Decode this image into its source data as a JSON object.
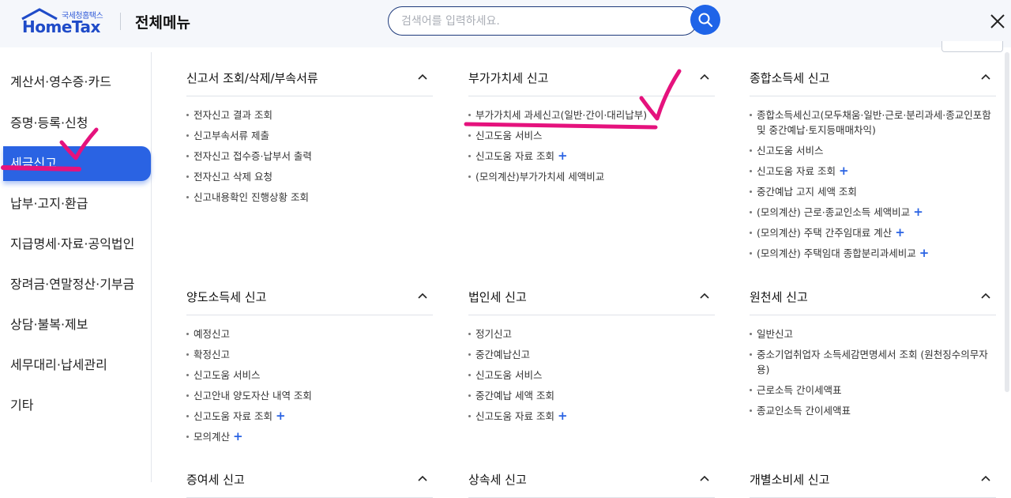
{
  "header": {
    "logo_sub": "국세청홈택스",
    "logo_main": "HomeTax",
    "menu_title": "전체메뉴",
    "search_placeholder": "검색어를 입력하세요."
  },
  "sidebar": {
    "items": [
      {
        "label": "계산서·영수증·카드"
      },
      {
        "label": "증명·등록·신청"
      },
      {
        "label": "세금신고",
        "active": true
      },
      {
        "label": "납부·고지·환급"
      },
      {
        "label": "지급명세·자료·공익법인"
      },
      {
        "label": "장려금·연말정산·기부금"
      },
      {
        "label": "상담·불복·제보"
      },
      {
        "label": "세무대리·납세관리"
      },
      {
        "label": "기타"
      }
    ]
  },
  "sections": [
    {
      "title": "신고서 조회/삭제/부속서류",
      "items": [
        {
          "label": "전자신고 결과 조회"
        },
        {
          "label": "신고부속서류 제출"
        },
        {
          "label": "전자신고 접수증·납부서 출력"
        },
        {
          "label": "전자신고 삭제 요청"
        },
        {
          "label": "신고내용확인 진행상황 조회"
        }
      ]
    },
    {
      "title": "부가가치세 신고",
      "items": [
        {
          "label": "부가가치세 과세신고(일반·간이·대리납부)"
        },
        {
          "label": "신고도움 서비스"
        },
        {
          "label": "신고도움 자료 조회",
          "plus": "+"
        },
        {
          "label": "(모의계산)부가가치세 세액비교"
        }
      ]
    },
    {
      "title": "종합소득세 신고",
      "items": [
        {
          "label": "종합소득세신고(모두채움·일반·근로·분리과세·종교인포함 및 중간예납·토지등매매차익)"
        },
        {
          "label": "신고도움 서비스"
        },
        {
          "label": "신고도움 자료 조회",
          "plus": "+"
        },
        {
          "label": "중간예납 고지 세액 조회"
        },
        {
          "label": "(모의계산) 근로·종교인소득 세액비교",
          "plus": "+"
        },
        {
          "label": "(모의계산) 주택 간주임대료 계산",
          "plus": "+"
        },
        {
          "label": "(모의계산) 주택임대 종합분리과세비교",
          "plus": "+"
        }
      ]
    },
    {
      "title": "양도소득세 신고",
      "items": [
        {
          "label": "예정신고"
        },
        {
          "label": "확정신고"
        },
        {
          "label": "신고도움 서비스"
        },
        {
          "label": "신고안내 양도자산 내역 조회"
        },
        {
          "label": "신고도움 자료 조회",
          "plus": "+"
        },
        {
          "label": "모의계산",
          "plus": "+"
        }
      ]
    },
    {
      "title": "법인세 신고",
      "items": [
        {
          "label": "정기신고"
        },
        {
          "label": "중간예납신고"
        },
        {
          "label": "신고도움 서비스"
        },
        {
          "label": "중간예납 세액 조회"
        },
        {
          "label": "신고도움 자료 조회",
          "plus": "+"
        }
      ]
    },
    {
      "title": "원천세 신고",
      "items": [
        {
          "label": "일반신고"
        },
        {
          "label": "중소기업취업자 소득세감면명세서 조회 (원천징수의무자용)"
        },
        {
          "label": "근로소득 간이세액표"
        },
        {
          "label": "종교인소득 간이세액표"
        }
      ]
    },
    {
      "title": "증여세 신고",
      "items": []
    },
    {
      "title": "상속세 신고",
      "items": []
    },
    {
      "title": "개별소비세 신고",
      "items": []
    }
  ],
  "colors": {
    "accent": "#2a63e3",
    "annotation": "#e5127d"
  }
}
